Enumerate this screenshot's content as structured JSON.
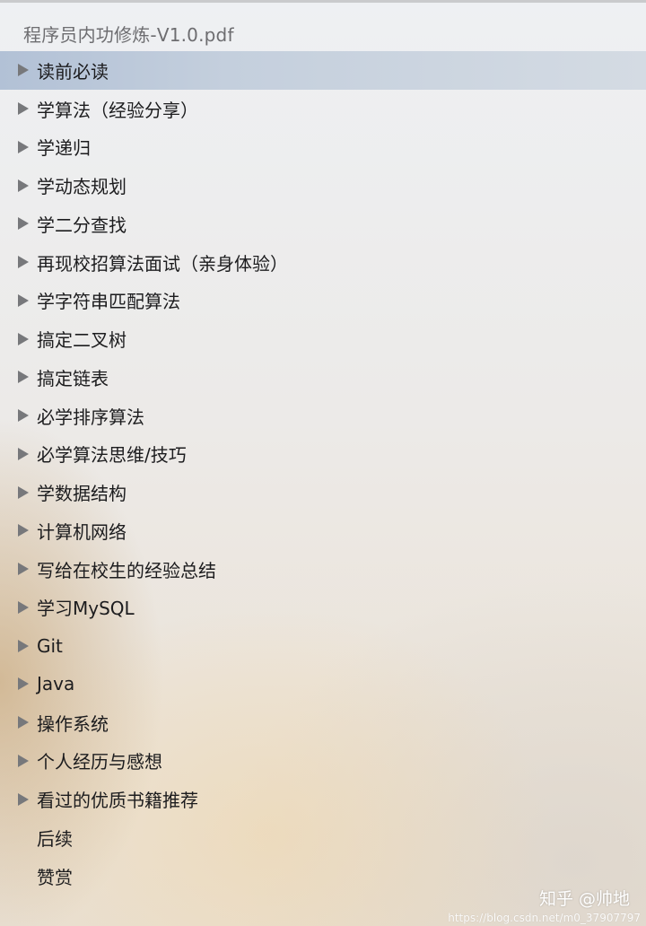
{
  "document": {
    "title": "程序员内功修炼-V1.0.pdf"
  },
  "outline": {
    "items": [
      {
        "label": "读前必读",
        "expandable": true,
        "selected": true
      },
      {
        "label": "学算法（经验分享）",
        "expandable": true
      },
      {
        "label": "学递归",
        "expandable": true
      },
      {
        "label": "学动态规划",
        "expandable": true
      },
      {
        "label": "学二分查找",
        "expandable": true
      },
      {
        "label": "再现校招算法面试（亲身体验）",
        "expandable": true
      },
      {
        "label": "学字符串匹配算法",
        "expandable": true
      },
      {
        "label": "搞定二叉树",
        "expandable": true
      },
      {
        "label": "搞定链表",
        "expandable": true
      },
      {
        "label": "必学排序算法",
        "expandable": true
      },
      {
        "label": "必学算法思维/技巧",
        "expandable": true
      },
      {
        "label": "学数据结构",
        "expandable": true
      },
      {
        "label": "计算机网络",
        "expandable": true
      },
      {
        "label": "写给在校生的经验总结",
        "expandable": true
      },
      {
        "label": "学习MySQL",
        "expandable": true
      },
      {
        "label": "Git",
        "expandable": true
      },
      {
        "label": "Java",
        "expandable": true
      },
      {
        "label": "操作系统",
        "expandable": true
      },
      {
        "label": "个人经历与感想",
        "expandable": true
      },
      {
        "label": "看过的优质书籍推荐",
        "expandable": true
      },
      {
        "label": "后续",
        "expandable": false
      },
      {
        "label": "赞赏",
        "expandable": false
      }
    ]
  },
  "watermark": {
    "text": "知乎 @帅地",
    "url": "https://blog.csdn.net/m0_37907797"
  },
  "colors": {
    "selection": "#b2c1d6",
    "disclosure": "#77787b",
    "title_text": "#6d6d70",
    "item_text": "#1c1c1e"
  }
}
